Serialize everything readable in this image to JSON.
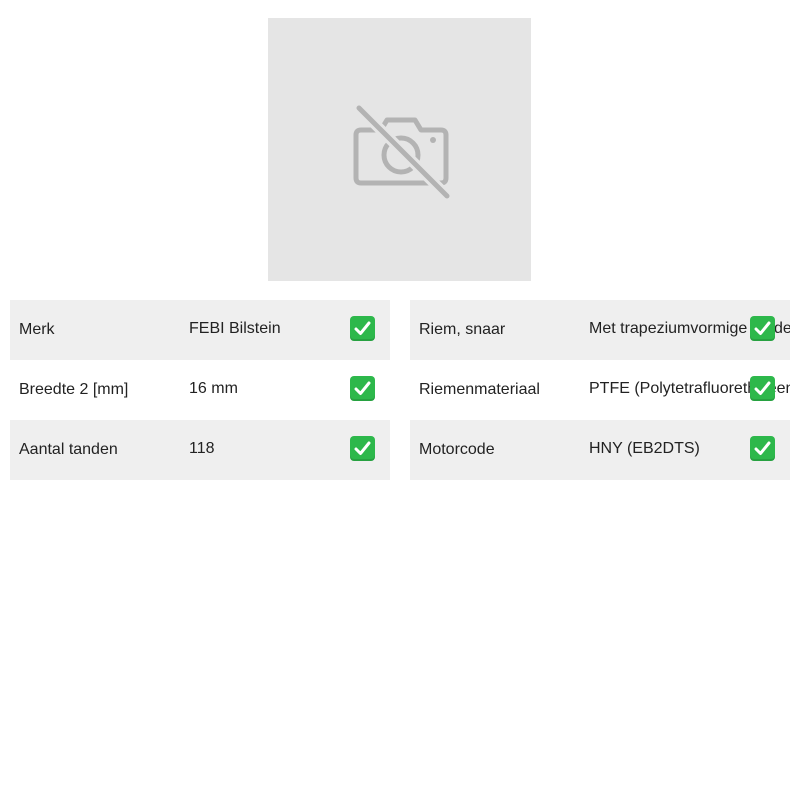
{
  "product_image": {
    "icon": "no-photo-icon",
    "background_color": "#e5e5e5",
    "icon_color": "#b3b3b3"
  },
  "specs_left": [
    {
      "label": "Merk",
      "value": "FEBI Bilstein"
    },
    {
      "label": "Breedte 2 [mm]",
      "value": "16 mm"
    },
    {
      "label": "Aantal tanden",
      "value": "118"
    }
  ],
  "specs_right": [
    {
      "label": "Riem, snaar",
      "value": "Met trapeziumvormige tanden"
    },
    {
      "label": "Riemenmateriaal",
      "value": "PTFE (Polytetrafluorethyleen)"
    },
    {
      "label": "Motorcode",
      "value": "HNY (EB2DTS)"
    }
  ],
  "colors": {
    "row_shade": "#efefef",
    "check_green": "#2db84b"
  },
  "check_icon": "check-mark-button-icon"
}
